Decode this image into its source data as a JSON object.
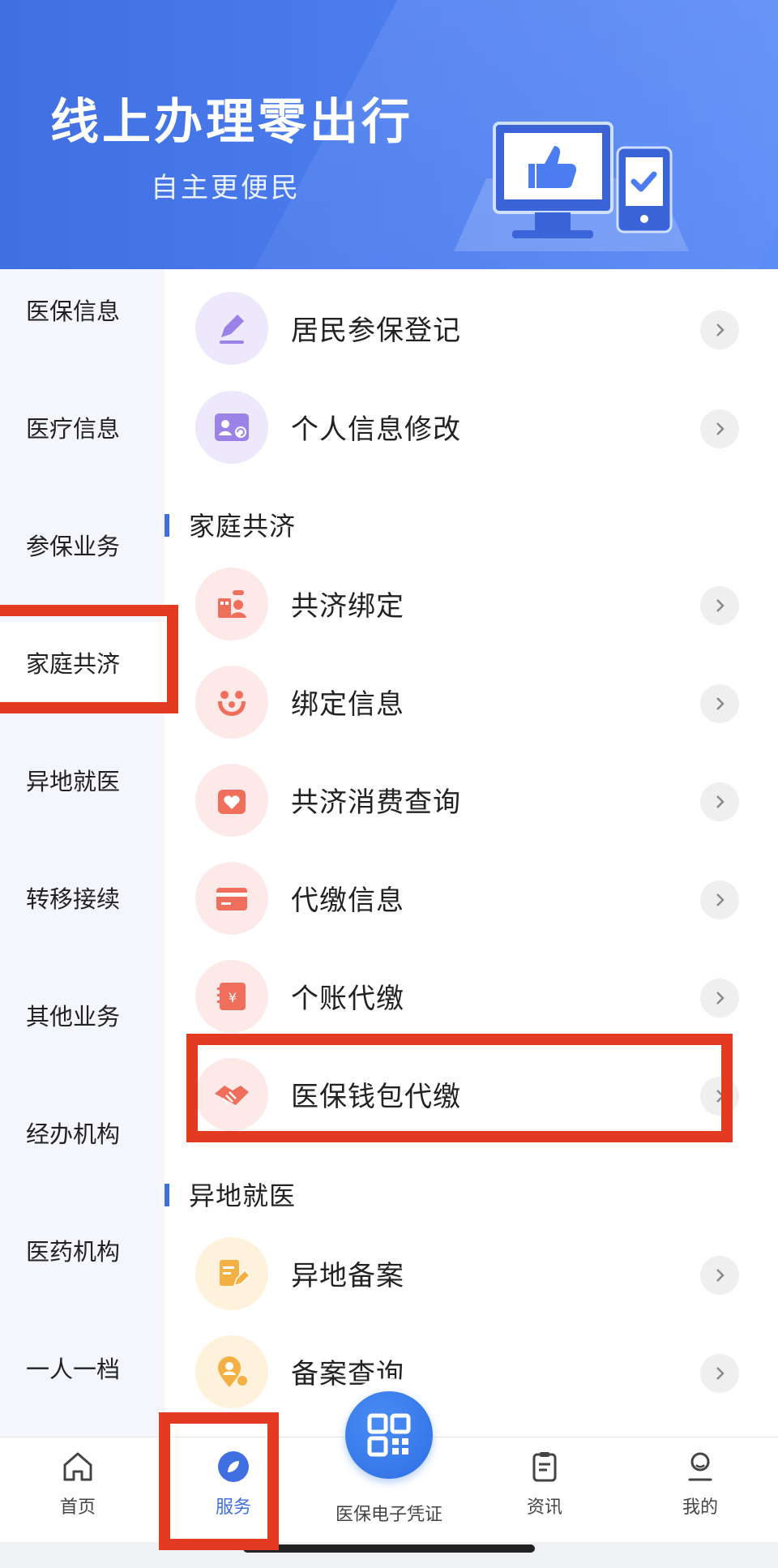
{
  "banner": {
    "title": "线上办理零出行",
    "subtitle": "自主更便民"
  },
  "sidebar": {
    "items": [
      {
        "label": "医保信息"
      },
      {
        "label": "医疗信息"
      },
      {
        "label": "参保业务"
      },
      {
        "label": "家庭共济"
      },
      {
        "label": "异地就医"
      },
      {
        "label": "转移接续"
      },
      {
        "label": "其他业务"
      },
      {
        "label": "经办机构"
      },
      {
        "label": "医药机构"
      },
      {
        "label": "一人一档"
      }
    ],
    "active": "家庭共济"
  },
  "content": {
    "top_items": [
      {
        "label": "居民参保登记",
        "icon": "pencil-icon"
      },
      {
        "label": "个人信息修改",
        "icon": "id-card-icon"
      }
    ],
    "sections": [
      {
        "title": "家庭共济",
        "items": [
          {
            "label": "共济绑定",
            "icon": "family-link-icon"
          },
          {
            "label": "绑定信息",
            "icon": "family-hug-icon"
          },
          {
            "label": "共济消费查询",
            "icon": "heart-box-icon"
          },
          {
            "label": "代缴信息",
            "icon": "card-icon"
          },
          {
            "label": "个账代缴",
            "icon": "yuan-book-icon"
          },
          {
            "label": "医保钱包代缴",
            "icon": "handshake-icon"
          }
        ]
      },
      {
        "title": "异地就医",
        "items": [
          {
            "label": "异地备案",
            "icon": "document-pen-icon"
          },
          {
            "label": "备案查询",
            "icon": "person-pin-icon"
          }
        ]
      }
    ]
  },
  "tabbar": {
    "items": [
      {
        "label": "首页",
        "icon": "home-icon"
      },
      {
        "label": "服务",
        "icon": "compass-icon"
      },
      {
        "label": "医保电子凭证",
        "icon": "qr-code-icon"
      },
      {
        "label": "资讯",
        "icon": "clipboard-icon"
      },
      {
        "label": "我的",
        "icon": "user-icon"
      }
    ],
    "active": "服务"
  },
  "colors": {
    "brand_blue": "#3f6fe0",
    "highlight_red": "#e23b22",
    "sidebar_bg": "#f4f6fb"
  }
}
